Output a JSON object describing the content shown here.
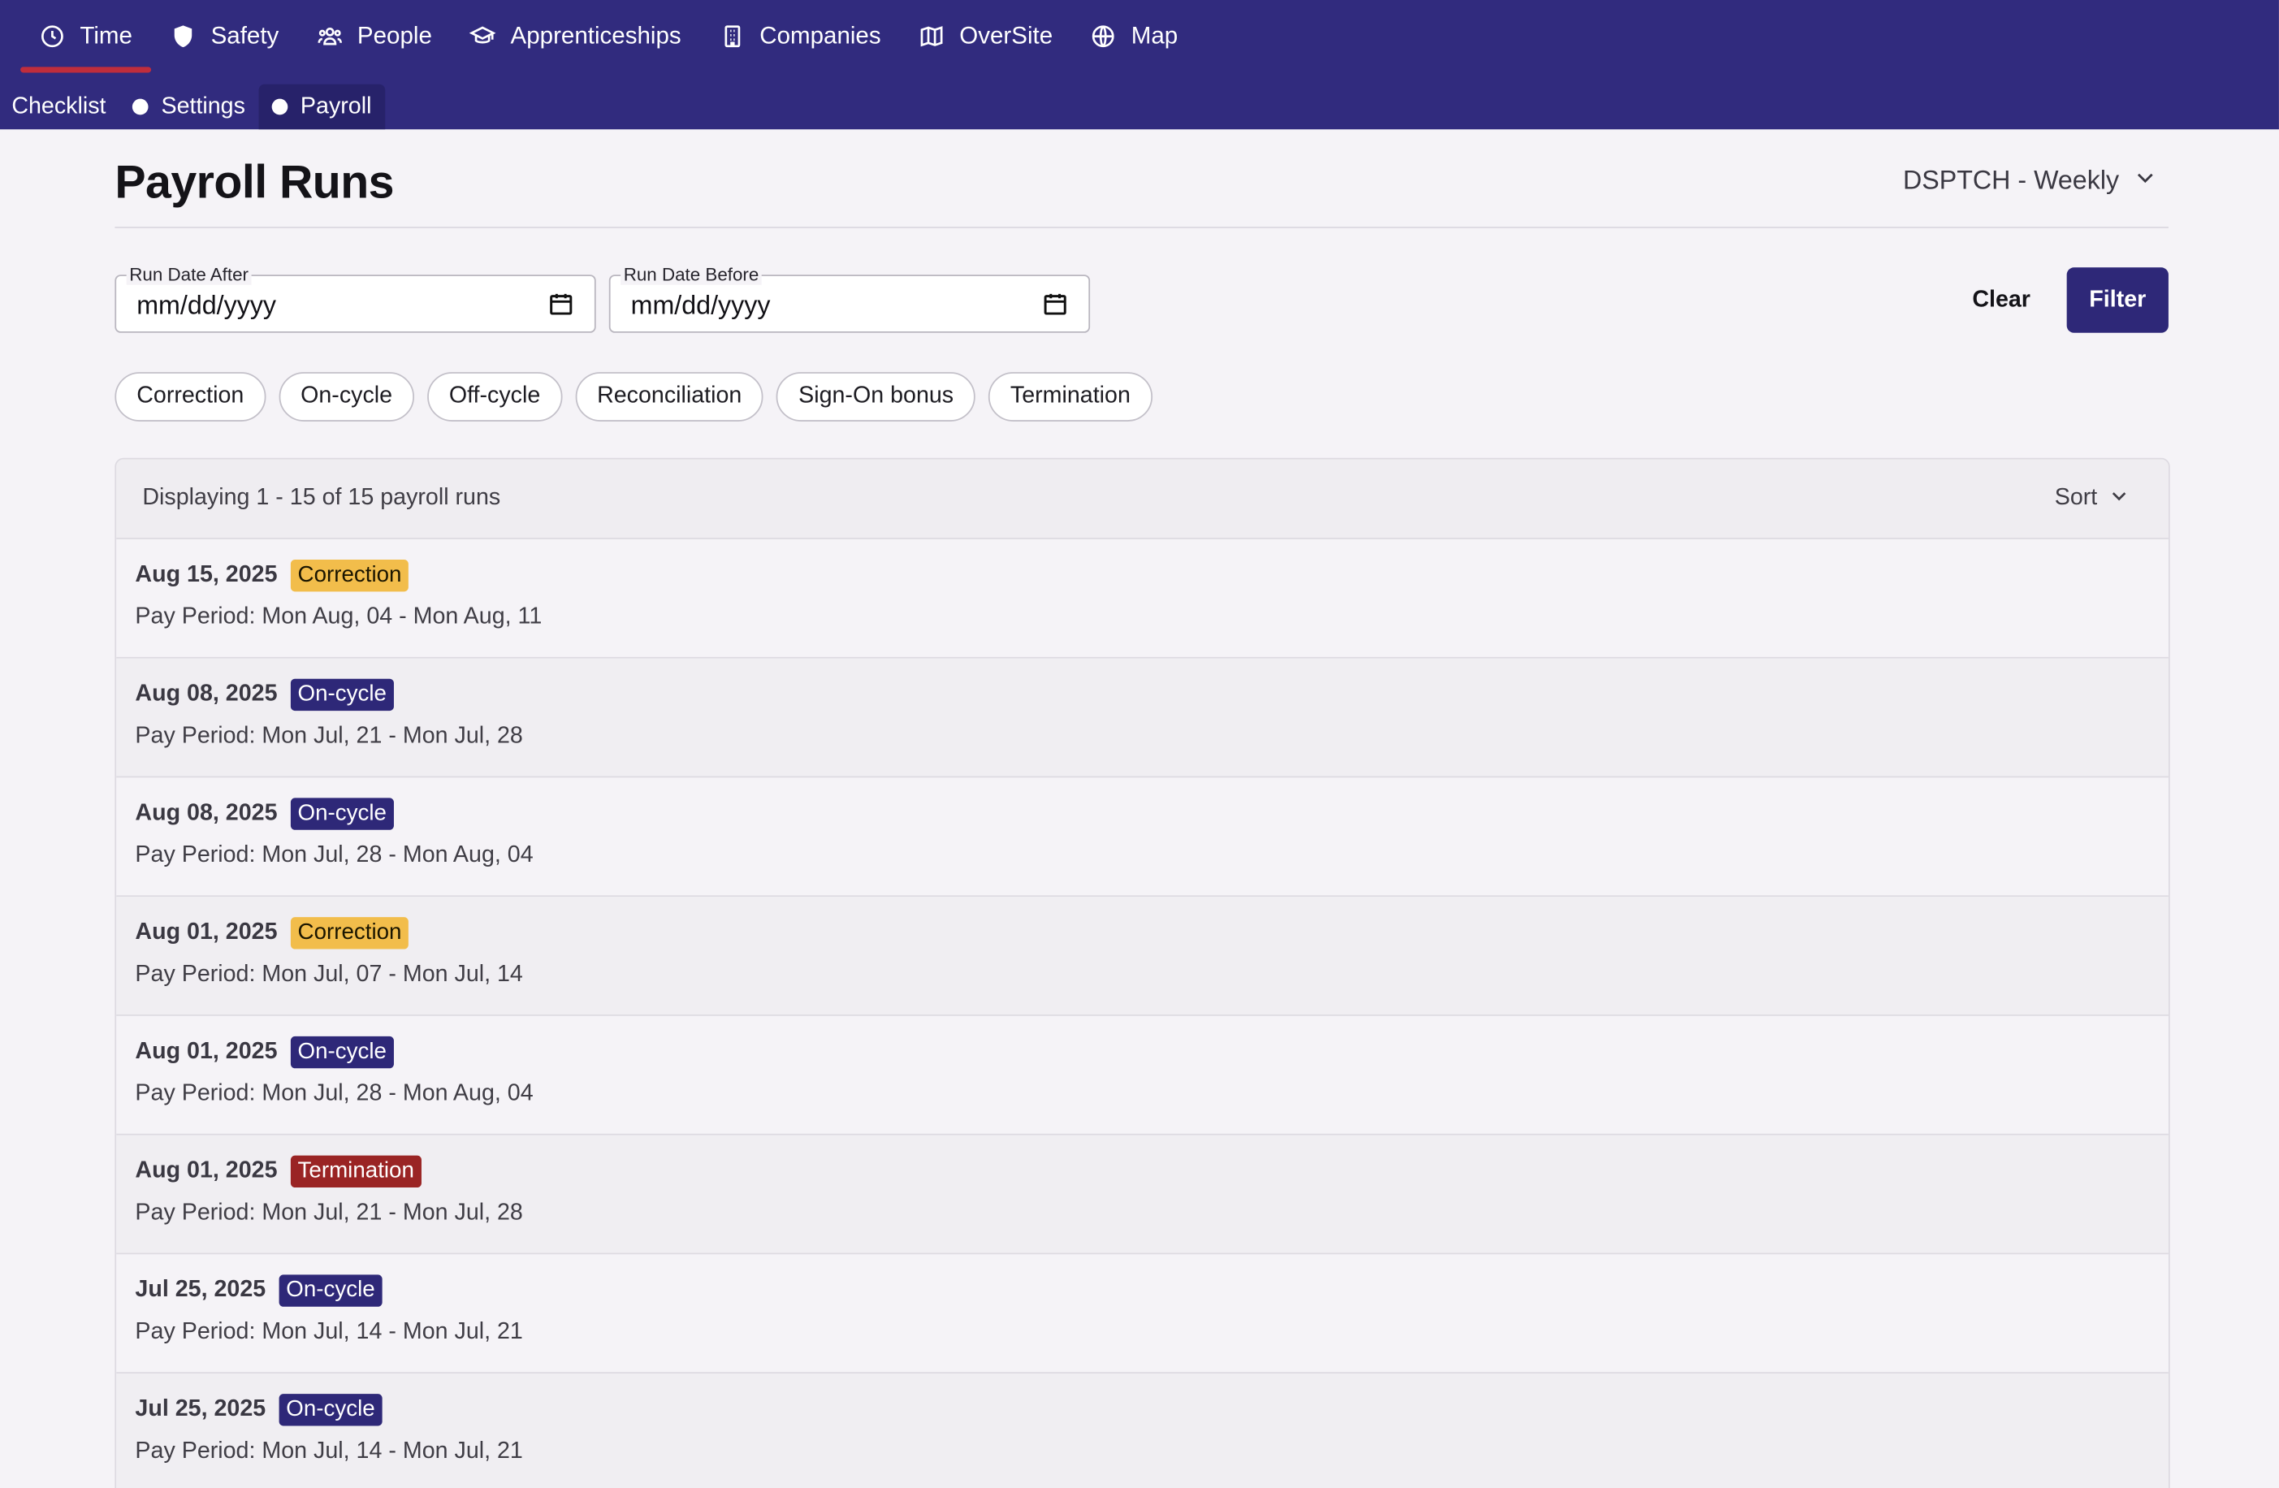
{
  "nav": {
    "items": [
      {
        "label": "Time",
        "icon": "clock-icon",
        "active": true
      },
      {
        "label": "Safety",
        "icon": "shield-icon",
        "active": false
      },
      {
        "label": "People",
        "icon": "people-icon",
        "active": false
      },
      {
        "label": "Apprenticeships",
        "icon": "graduation-cap-icon",
        "active": false
      },
      {
        "label": "Companies",
        "icon": "building-icon",
        "active": false
      },
      {
        "label": "OverSite",
        "icon": "map-fold-icon",
        "active": false
      },
      {
        "label": "Map",
        "icon": "globe-icon",
        "active": false
      }
    ],
    "active_color": "#c02d3c",
    "background": "#312b7e"
  },
  "subnav": {
    "items": [
      {
        "label": "Checklist",
        "dot": false,
        "active": false
      },
      {
        "label": "Settings",
        "dot": true,
        "active": false
      },
      {
        "label": "Payroll",
        "dot": true,
        "active": true
      }
    ]
  },
  "header": {
    "title": "Payroll Runs",
    "company_select": "DSPTCH - Weekly"
  },
  "filters": {
    "run_date_after": {
      "label": "Run Date After",
      "value": "mm/dd/yyyy"
    },
    "run_date_before": {
      "label": "Run Date Before",
      "value": "mm/dd/yyyy"
    },
    "clear_label": "Clear",
    "filter_label": "Filter",
    "chips": [
      "Correction",
      "On-cycle",
      "Off-cycle",
      "Reconciliation",
      "Sign-On bonus",
      "Termination"
    ]
  },
  "list": {
    "count_text": "Displaying 1 - 15 of 15 payroll runs",
    "sort_label": "Sort",
    "rows": [
      {
        "date": "Aug 15, 2025",
        "type": "Correction",
        "type_key": "correction",
        "period": "Pay Period: Mon Aug, 04 - Mon Aug, 11"
      },
      {
        "date": "Aug 08, 2025",
        "type": "On-cycle",
        "type_key": "on-cycle",
        "period": "Pay Period: Mon Jul, 21 - Mon Jul, 28"
      },
      {
        "date": "Aug 08, 2025",
        "type": "On-cycle",
        "type_key": "on-cycle",
        "period": "Pay Period: Mon Jul, 28 - Mon Aug, 04"
      },
      {
        "date": "Aug 01, 2025",
        "type": "Correction",
        "type_key": "correction",
        "period": "Pay Period: Mon Jul, 07 - Mon Jul, 14"
      },
      {
        "date": "Aug 01, 2025",
        "type": "On-cycle",
        "type_key": "on-cycle",
        "period": "Pay Period: Mon Jul, 28 - Mon Aug, 04"
      },
      {
        "date": "Aug 01, 2025",
        "type": "Termination",
        "type_key": "termination",
        "period": "Pay Period: Mon Jul, 21 - Mon Jul, 28"
      },
      {
        "date": "Jul 25, 2025",
        "type": "On-cycle",
        "type_key": "on-cycle",
        "period": "Pay Period: Mon Jul, 14 - Mon Jul, 21"
      },
      {
        "date": "Jul 25, 2025",
        "type": "On-cycle",
        "type_key": "on-cycle",
        "period": "Pay Period: Mon Jul, 14 - Mon Jul, 21"
      }
    ]
  },
  "colors": {
    "correction": "#f2bd4b",
    "on-cycle": "#2e2878",
    "termination": "#9a2424",
    "primary": "#2e2878"
  }
}
